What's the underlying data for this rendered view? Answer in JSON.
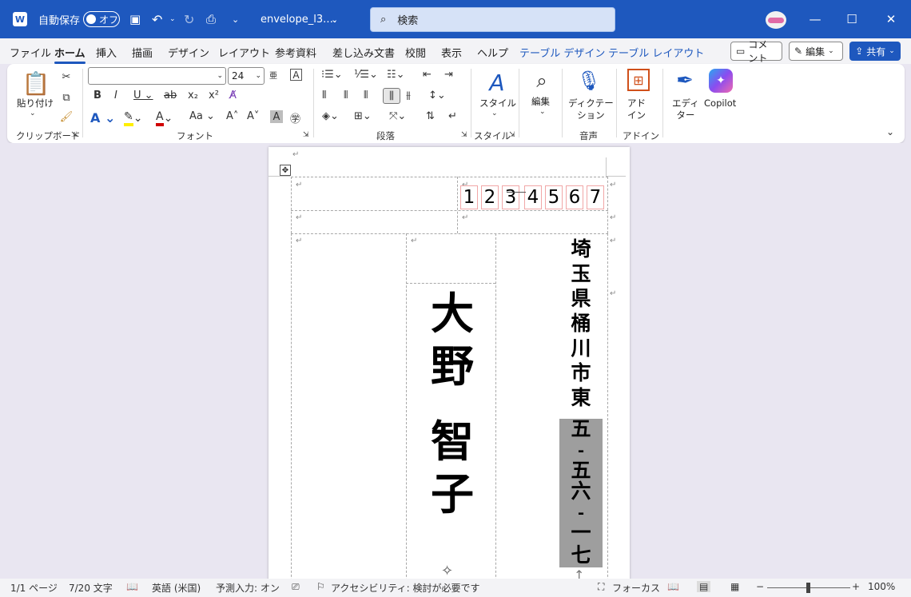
{
  "titlebar": {
    "autosave_label": "自動保存",
    "autosave_state": "オフ",
    "doc_name": "envelope_l3.…",
    "search_placeholder": "検索"
  },
  "menu": {
    "tabs": [
      "ファイル",
      "ホーム",
      "挿入",
      "描画",
      "デザイン",
      "レイアウト",
      "参考資料",
      "差し込み文書",
      "校閲",
      "表示",
      "ヘルプ",
      "テーブル デザイン",
      "テーブル レイアウト"
    ],
    "active_tab": "ホーム",
    "comment_label": "コメント",
    "edit_label": "編集",
    "share_label": "共有"
  },
  "ribbon": {
    "clipboard": {
      "paste_label": "貼り付け",
      "group_label": "クリップボード"
    },
    "font": {
      "font_name": "",
      "font_size": "24",
      "group_label": "フォント"
    },
    "paragraph": {
      "group_label": "段落"
    },
    "styles": {
      "styles_label": "スタイル",
      "group_label": "スタイル"
    },
    "editing": {
      "edit_label": "編集"
    },
    "voice": {
      "dictate_label": "ディクテー\nション",
      "group_label": "音声"
    },
    "addins": {
      "addins_label": "アド\nイン",
      "group_label": "アドイン"
    },
    "editor": {
      "editor_label": "エディ\nター"
    },
    "copilot": {
      "copilot_label": "Copilot"
    }
  },
  "document": {
    "zip_digits": [
      "1",
      "2",
      "3",
      "4",
      "5",
      "6",
      "7"
    ],
    "recipient_name": [
      "大",
      "野",
      "智",
      "子"
    ],
    "address_chars": [
      "埼",
      "玉",
      "県",
      "桶",
      "川",
      "市",
      "東"
    ],
    "address_number_chars": [
      "五",
      "-",
      "五",
      "六",
      "-",
      "一",
      "七"
    ],
    "highlight_color": "#9e9e9e"
  },
  "status": {
    "page": "1/1 ページ",
    "words": "7/20 文字",
    "language": "英語 (米国)",
    "predictive": "予測入力: オン",
    "accessibility": "アクセシビリティ: 検討が必要です",
    "focus": "フォーカス",
    "zoom": "100%"
  },
  "colors": {
    "brand_blue": "#1e58be"
  }
}
